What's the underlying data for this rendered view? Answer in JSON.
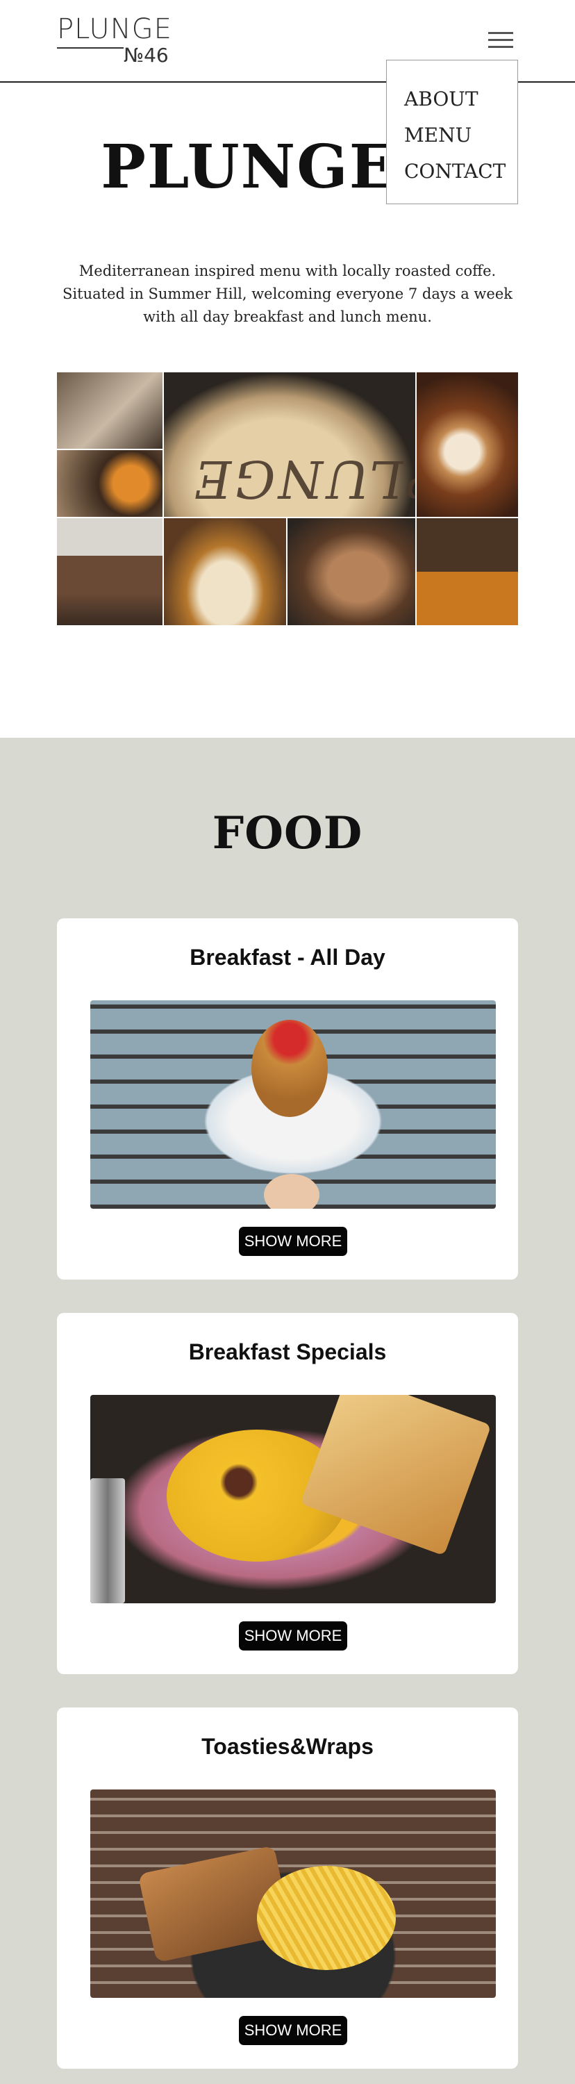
{
  "header": {
    "logo_top": "PLUNGE",
    "logo_num": "№46",
    "menu_items": [
      "ABOUT",
      "MENU",
      "CONTACT"
    ]
  },
  "hero": {
    "title": "PLUNGE N",
    "intro": "Mediterranean inspired menu with locally roasted coffe. Situated in Summer Hill, welcoming everyone 7 days a week with all day breakfast and lunch menu."
  },
  "collage": {
    "table_lettering": "PLUNGE"
  },
  "food": {
    "title": "FOOD",
    "cards": [
      {
        "title": "Breakfast - All Day",
        "button": "SHOW MORE"
      },
      {
        "title": "Breakfast Specials",
        "button": "SHOW MORE"
      },
      {
        "title": "Toasties&Wraps",
        "button": "SHOW MORE"
      }
    ]
  },
  "colors": {
    "section_bg": "#d8d9d0",
    "button_bg": "#050505",
    "card_bg": "#ffffff"
  }
}
